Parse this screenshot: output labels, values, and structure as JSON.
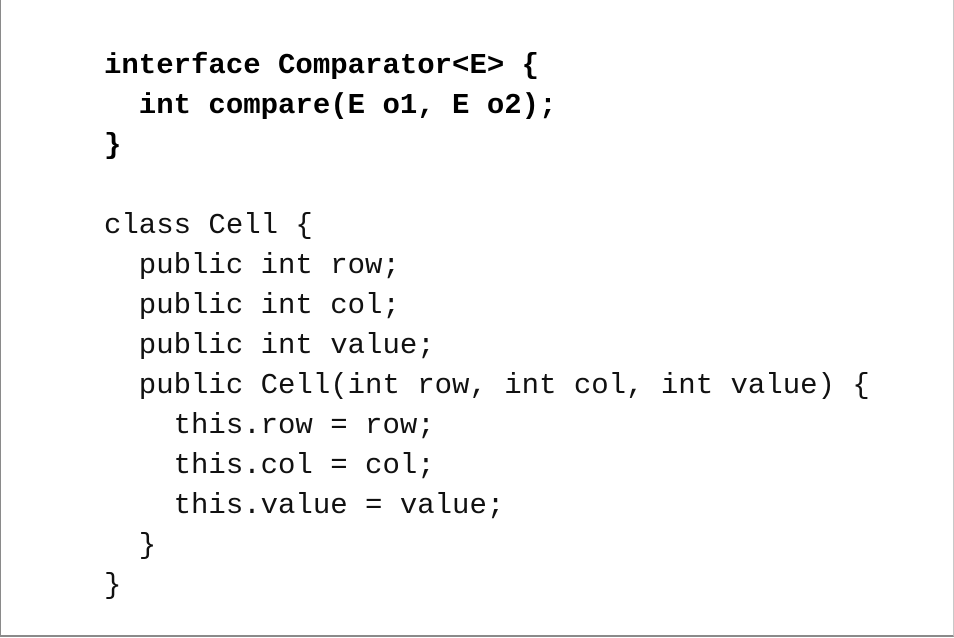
{
  "code_block": {
    "lines": [
      {
        "text": "interface Comparator<E> {",
        "bold": true
      },
      {
        "text": "  int compare(E o1, E o2);",
        "bold": true
      },
      {
        "text": "}",
        "bold": true
      },
      {
        "text": "",
        "bold": false
      },
      {
        "text": "class Cell {",
        "bold": false
      },
      {
        "text": "  public int row;",
        "bold": false
      },
      {
        "text": "  public int col;",
        "bold": false
      },
      {
        "text": "  public int value;",
        "bold": false
      },
      {
        "text": "  public Cell(int row, int col, int value) {",
        "bold": false
      },
      {
        "text": "    this.row = row;",
        "bold": false
      },
      {
        "text": "    this.col = col;",
        "bold": false
      },
      {
        "text": "    this.value = value;",
        "bold": false
      },
      {
        "text": "  }",
        "bold": false
      },
      {
        "text": "}",
        "bold": false
      }
    ]
  }
}
